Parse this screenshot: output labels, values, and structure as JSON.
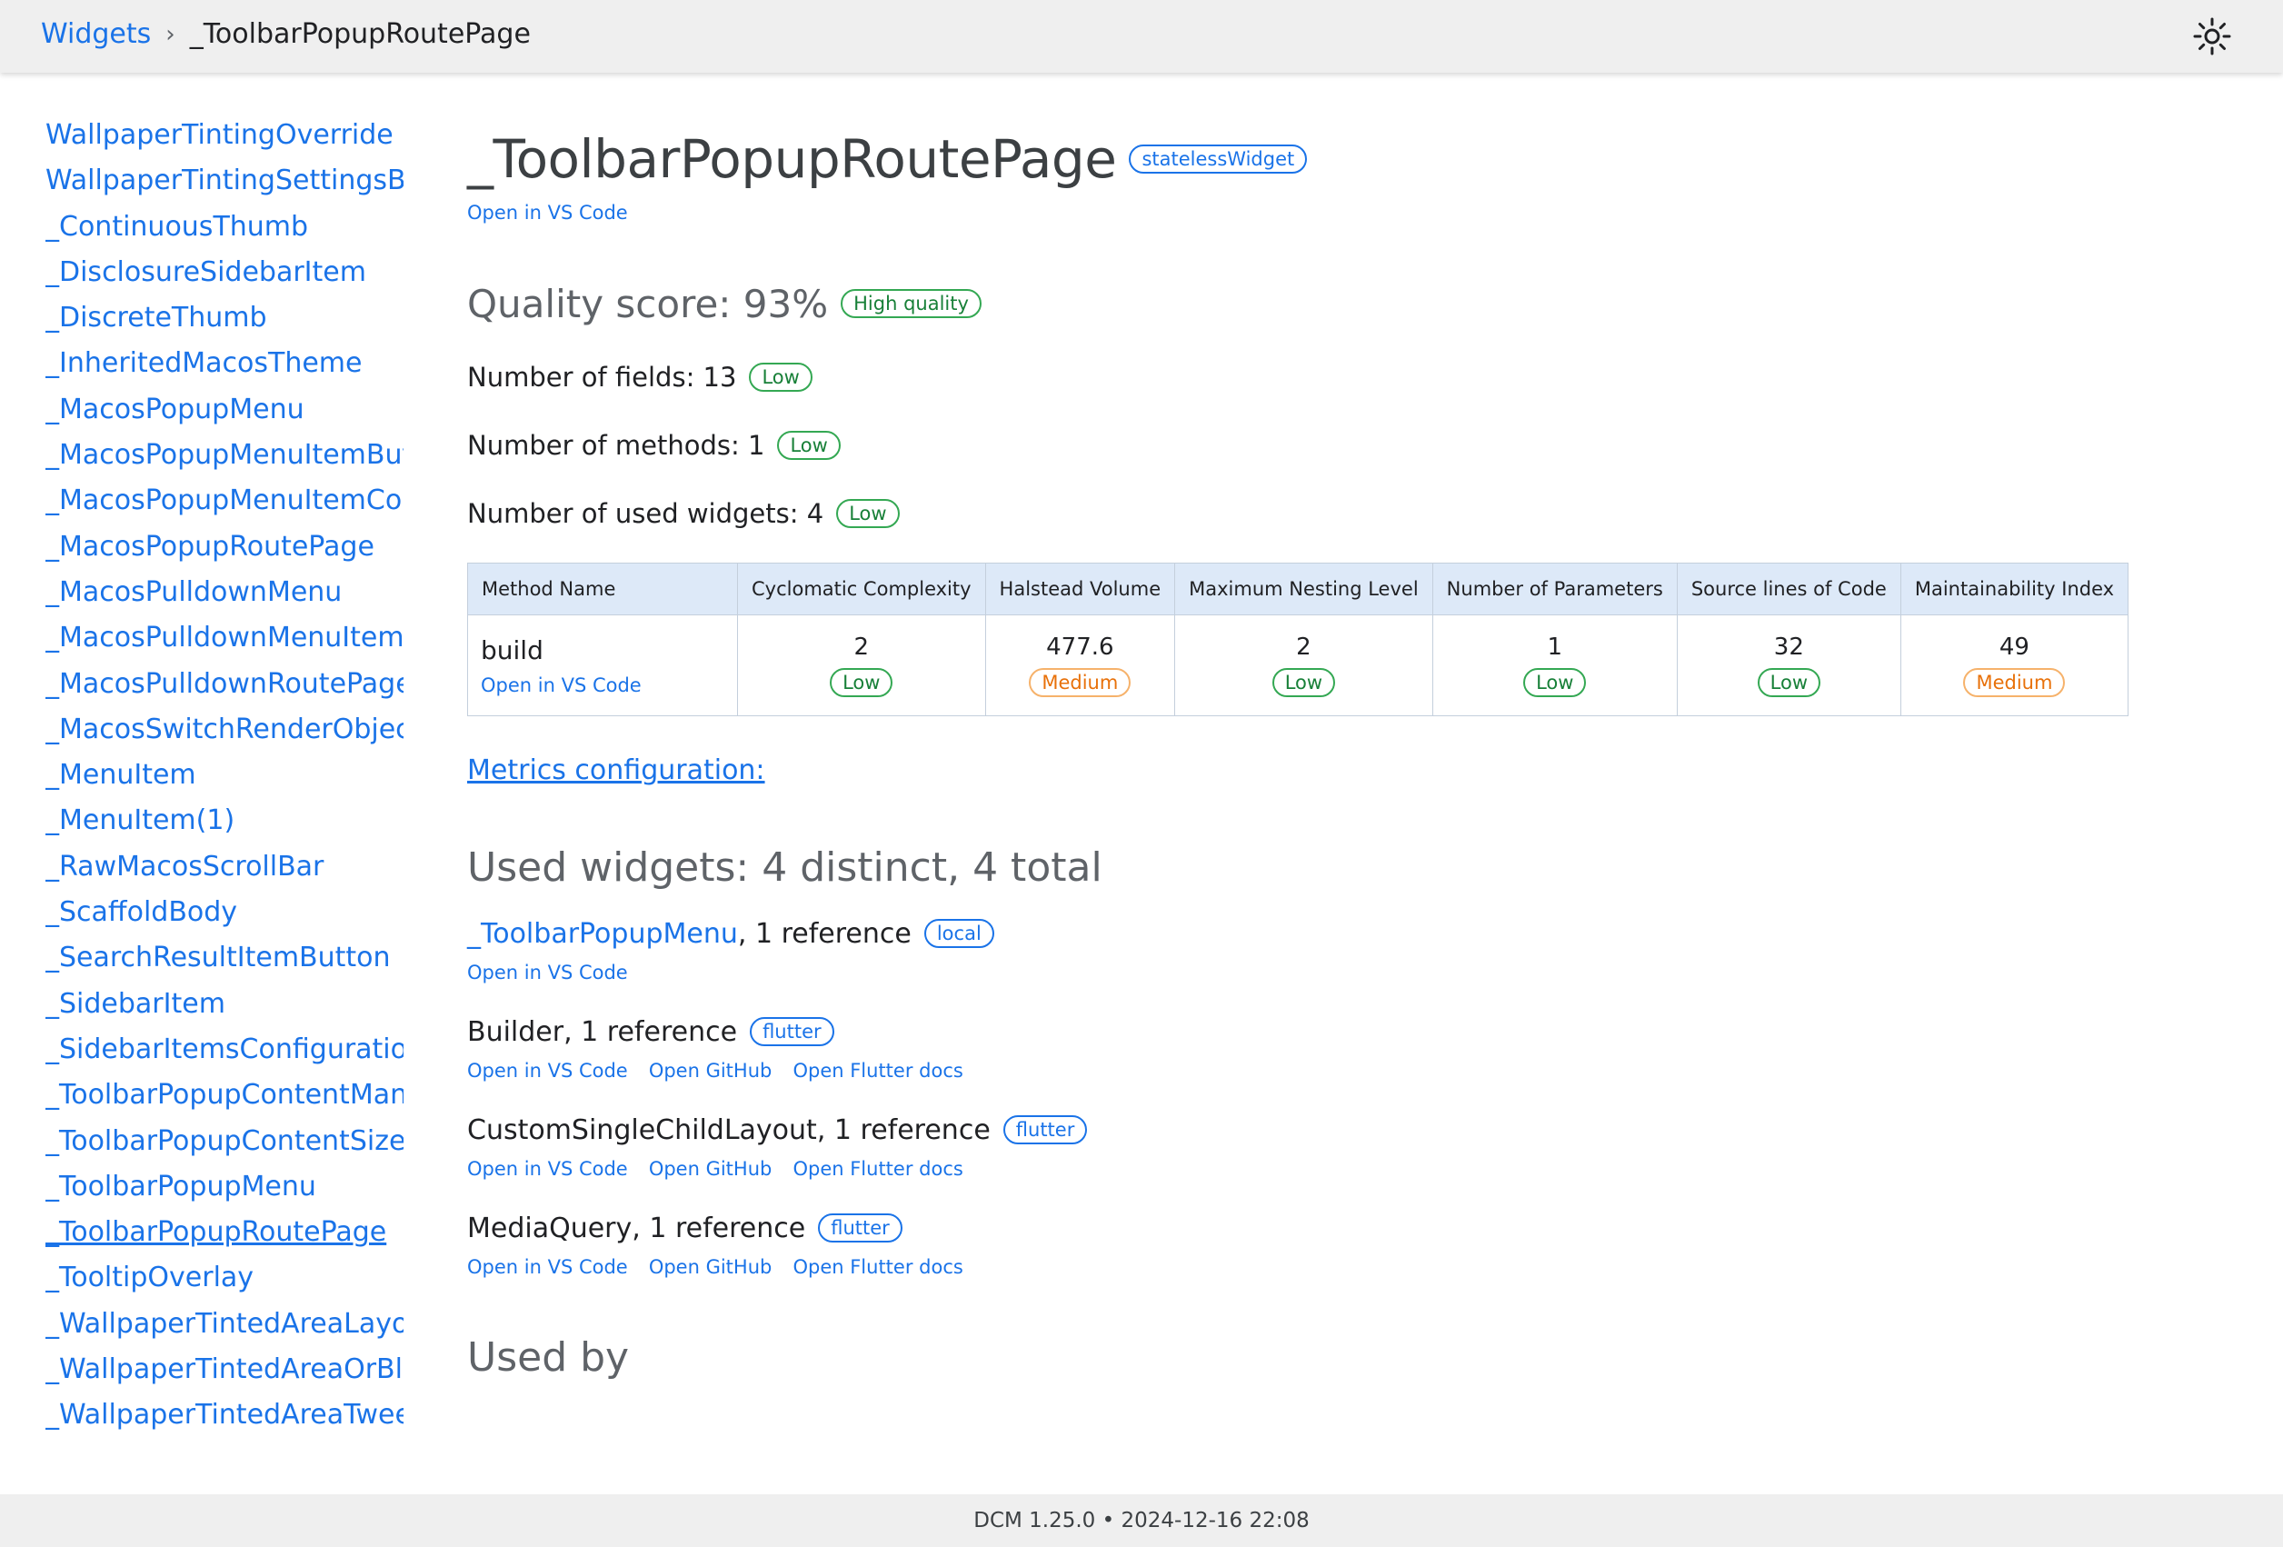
{
  "header": {
    "breadcrumb_root": "Widgets",
    "breadcrumb_separator": "›",
    "breadcrumb_current": "_ToolbarPopupRoutePage",
    "theme_icon": "sun-icon"
  },
  "sidebar": {
    "items": [
      "WallpaperTintingOverride",
      "WallpaperTintingSettingsBuilder",
      "_ContinuousThumb",
      "_DisclosureSidebarItem",
      "_DiscreteThumb",
      "_InheritedMacosTheme",
      "_MacosPopupMenu",
      "_MacosPopupMenuItemButton",
      "_MacosPopupMenuItemContent",
      "_MacosPopupRoutePage",
      "_MacosPulldownMenu",
      "_MacosPulldownMenuItemButton",
      "_MacosPulldownRoutePage",
      "_MacosSwitchRenderObjectWidget",
      "_MenuItem",
      "_MenuItem(1)",
      "_RawMacosScrollBar",
      "_ScaffoldBody",
      "_SearchResultItemButton",
      "_SidebarItem",
      "_SidebarItemsConfiguration",
      "_ToolbarPopupContentManager",
      "_ToolbarPopupContentSizeInfo",
      "_ToolbarPopupMenu",
      "_ToolbarPopupRoutePage",
      "_TooltipOverlay",
      "_WallpaperTintedAreaLayoutBuilder",
      "_WallpaperTintedAreaOrBlurBuilder",
      "_WallpaperTintedAreaTweenAnimation"
    ],
    "active_index": 24
  },
  "main": {
    "title": "_ToolbarPopupRoutePage",
    "type_badge": "statelessWidget",
    "open_vscode": "Open in VS Code",
    "quality_title": "Quality score: 93%",
    "quality_badge": "High quality",
    "metrics": [
      {
        "label": "Number of fields: 13",
        "badge": "Low"
      },
      {
        "label": "Number of methods: 1",
        "badge": "Low"
      },
      {
        "label": "Number of used widgets: 4",
        "badge": "Low"
      }
    ],
    "table": {
      "headers": [
        "Method Name",
        "Cyclomatic Complexity",
        "Halstead Volume",
        "Maximum Nesting Level",
        "Number of Parameters",
        "Source lines of Code",
        "Maintainability Index"
      ],
      "row": {
        "method": "build",
        "method_link": "Open in VS Code",
        "values": [
          "2",
          "477.6",
          "2",
          "1",
          "32",
          "49"
        ],
        "badges": [
          "Low",
          "Medium",
          "Low",
          "Low",
          "Low",
          "Medium"
        ]
      }
    },
    "metrics_config_link": "Metrics configuration:",
    "used_widgets_title": "Used widgets: 4 distinct, 4 total",
    "used_widgets": [
      {
        "name": "_ToolbarPopupMenu",
        "suffix": ", 1 reference",
        "badge": "local",
        "links": [
          "Open in VS Code"
        ]
      },
      {
        "name": "Builder",
        "suffix": ", 1 reference",
        "badge": "flutter",
        "links": [
          "Open in VS Code",
          "Open GitHub",
          "Open Flutter docs"
        ]
      },
      {
        "name": "CustomSingleChildLayout",
        "suffix": ", 1 reference",
        "badge": "flutter",
        "links": [
          "Open in VS Code",
          "Open GitHub",
          "Open Flutter docs"
        ]
      },
      {
        "name": "MediaQuery",
        "suffix": ", 1 reference",
        "badge": "flutter",
        "links": [
          "Open in VS Code",
          "Open GitHub",
          "Open Flutter docs"
        ]
      }
    ],
    "used_by_title": "Used by"
  },
  "footer": {
    "text": "DCM 1.25.0 • 2024-12-16 22:08"
  },
  "colors": {
    "link": "#1a73e8",
    "low": "#188038",
    "medium": "#e8710a",
    "header_bg": "#efefef",
    "table_header_bg": "#dde9f8"
  }
}
